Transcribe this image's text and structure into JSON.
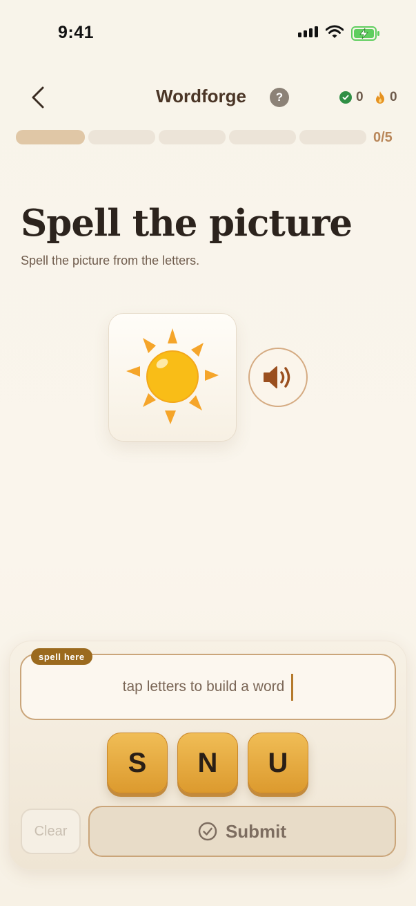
{
  "status_bar": {
    "time": "9:41"
  },
  "header": {
    "title": "Wordforge",
    "help_label": "?",
    "correct_count": "0",
    "streak_count": "0"
  },
  "progress": {
    "label": "0/5",
    "completed": 1,
    "total": 5
  },
  "prompt": {
    "heading": "Spell the picture",
    "instructions": "Spell the picture from the letters.",
    "picture_icon": "sun-icon"
  },
  "answer": {
    "tag": "spell here",
    "placeholder": "tap letters to build a word"
  },
  "letters": [
    "S",
    "N",
    "U"
  ],
  "actions": {
    "clear": "Clear",
    "submit": "Submit"
  },
  "colors": {
    "accent": "#dc9a2e",
    "brand_brown": "#4a3526",
    "success": "#2f8f45",
    "tag": "#9b6a1e"
  }
}
